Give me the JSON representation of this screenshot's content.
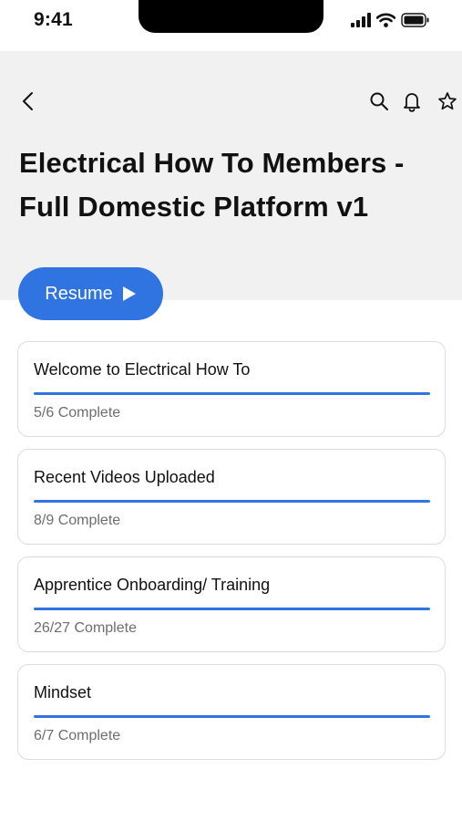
{
  "status_bar": {
    "time": "9:41",
    "icons": [
      "cellular-signal-icon",
      "wifi-icon",
      "battery-icon"
    ]
  },
  "nav": {
    "icons": [
      "back-icon",
      "search-icon",
      "bell-icon",
      "star-icon"
    ]
  },
  "page": {
    "title": "Electrical How To Members - Full Domestic Platform v1"
  },
  "resume": {
    "label": "Resume",
    "icon": "play-icon"
  },
  "colors": {
    "accent": "#2f74e0",
    "header_bg": "#f1f1f1",
    "muted_text": "#6d6d6d"
  },
  "sections": [
    {
      "title": "Welcome to Electrical How To",
      "status": "5/6 Complete",
      "progress": 1.0
    },
    {
      "title": "Recent Videos Uploaded",
      "status": "8/9 Complete",
      "progress": 1.0
    },
    {
      "title": "Apprentice Onboarding/ Training",
      "status": "26/27 Complete",
      "progress": 1.0
    },
    {
      "title": "Mindset",
      "status": "6/7 Complete",
      "progress": 1.0
    }
  ]
}
